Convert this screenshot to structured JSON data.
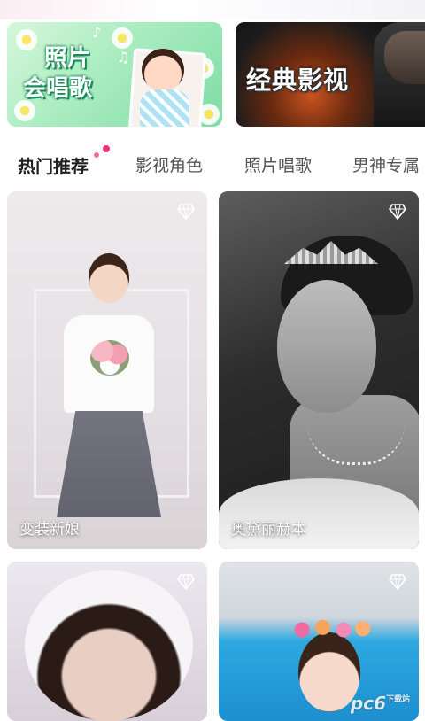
{
  "banners": [
    {
      "title_line1": "照片",
      "title_line2": "会唱歌"
    },
    {
      "title": "经典影视"
    }
  ],
  "tabs": [
    {
      "label": "热门推荐",
      "active": true
    },
    {
      "label": "影视角色"
    },
    {
      "label": "照片唱歌"
    },
    {
      "label": "男神专属"
    }
  ],
  "cards": [
    {
      "label": "变装新娘",
      "icon": "diamond-icon"
    },
    {
      "label": "奥黛丽赫本",
      "icon": "diamond-icon"
    },
    {
      "label": "",
      "icon": "diamond-icon"
    },
    {
      "label": "",
      "icon": "diamond-icon"
    }
  ],
  "watermark": {
    "text": "pc6",
    "sub": "下载站"
  },
  "colors": {
    "accent": "#e8317c",
    "tab_active": "#222222",
    "tab_inactive": "#555555"
  }
}
